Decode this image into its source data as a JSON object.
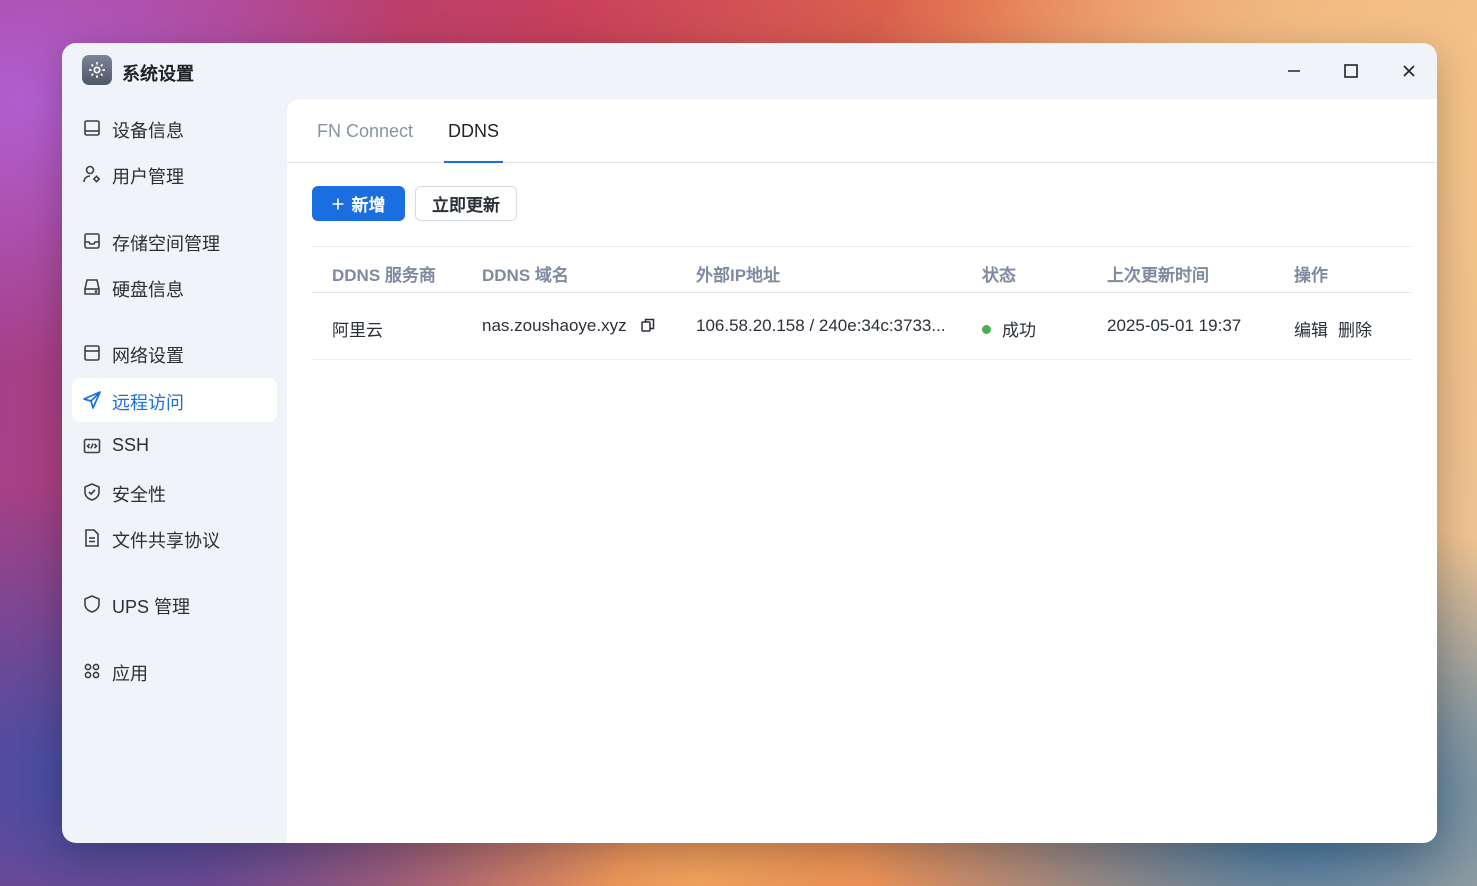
{
  "window": {
    "title": "系统设置"
  },
  "sidebar": {
    "items": [
      {
        "label": "设备信息",
        "icon": "monitor-icon"
      },
      {
        "label": "用户管理",
        "icon": "user-settings-icon"
      },
      {
        "label": "存储空间管理",
        "icon": "inbox-icon"
      },
      {
        "label": "硬盘信息",
        "icon": "harddisk-icon"
      },
      {
        "label": "网络设置",
        "icon": "network-icon"
      },
      {
        "label": "远程访问",
        "icon": "send-icon",
        "active": true
      },
      {
        "label": "SSH",
        "icon": "code-icon"
      },
      {
        "label": "安全性",
        "icon": "shield-check-icon"
      },
      {
        "label": "文件共享协议",
        "icon": "file-text-icon"
      },
      {
        "label": "UPS 管理",
        "icon": "shield-icon"
      },
      {
        "label": "应用",
        "icon": "apps-icon"
      }
    ]
  },
  "tabs": [
    {
      "label": "FN Connect",
      "active": false
    },
    {
      "label": "DDNS",
      "active": true
    }
  ],
  "toolbar": {
    "add_label": "新增",
    "update_label": "立即更新"
  },
  "table": {
    "headers": [
      "DDNS 服务商",
      "DDNS 域名",
      "外部IP地址",
      "状态",
      "上次更新时间",
      "操作"
    ],
    "rows": [
      {
        "provider": "阿里云",
        "domain": "nas.zoushaoye.xyz",
        "ip": "106.58.20.158 / 240e:34c:3733...",
        "status": "成功",
        "updated": "2025-05-01 19:37",
        "edit": "编辑",
        "delete": "删除"
      }
    ]
  },
  "colors": {
    "accent": "#1a6ee0",
    "success": "#4caf50"
  }
}
